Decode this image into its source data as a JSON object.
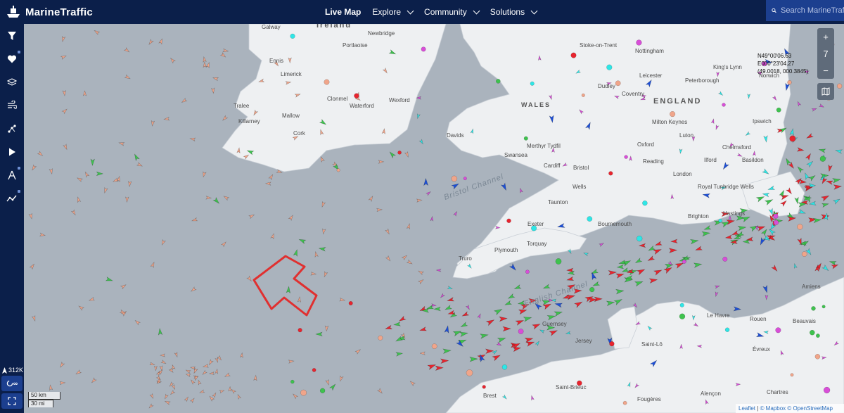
{
  "header": {
    "logo_text": "MarineTraffic",
    "nav": [
      {
        "label": "Live Map",
        "active": true
      },
      {
        "label": "Explore",
        "active": false
      },
      {
        "label": "Community",
        "active": false
      },
      {
        "label": "Solutions",
        "active": false
      }
    ],
    "search_placeholder": "Search MarineTraffic"
  },
  "sidebar": {
    "buttons": [
      {
        "icon": "filter-icon"
      },
      {
        "icon": "heart-icon",
        "locked": true
      },
      {
        "icon": "layers-icon"
      },
      {
        "icon": "wind-icon"
      },
      {
        "icon": "measure-icon"
      },
      {
        "icon": "play-icon"
      },
      {
        "icon": "compass-icon",
        "locked": true
      },
      {
        "icon": "analytics-icon",
        "locked": true
      }
    ],
    "vessel_count": "312K",
    "layer_label": "∞"
  },
  "map": {
    "zoom_level": "7",
    "coordinates": [
      "N49°00'06.63",
      "E000°23'04.27",
      "(49.0018, 000.3845)"
    ],
    "scale": {
      "metric": "50 km",
      "imperial": "30 mi"
    },
    "attribution": {
      "leaflet": "Leaflet",
      "mapbox": "© Mapbox",
      "osm": "© OpenStreetMap"
    },
    "places": {
      "ireland": "Ireland",
      "galway": "Galway",
      "newbridge": "Newbridge",
      "portlaoise": "Portlaoise",
      "ennis": "Ennis",
      "limerick": "Limerick",
      "clonmel": "Clonmel",
      "waterford": "Waterford",
      "wexford": "Wexford",
      "tralee": "Tralee",
      "mallow": "Mallow",
      "killarney": "Killarney",
      "cork": "Cork",
      "wales": "WALES",
      "davids": "Davids",
      "swansea": "Swansea",
      "merthyr": "Merthyr Tydfil",
      "cardiff": "Cardiff",
      "bristol": "Bristol",
      "wells": "Wells",
      "taunton": "Taunton",
      "bristol_channel": "Bristol Channel",
      "england": "ENGLAND",
      "stoke": "Stoke-on-Trent",
      "nottingham": "Nottingham",
      "leicester": "Leicester",
      "peterborough": "Peterborough",
      "kings_lynn": "King's Lynn",
      "norwich": "Norwich",
      "dudley": "Dudley",
      "coventry": "Coventry",
      "milton_keynes": "Milton Keynes",
      "luton": "Luton",
      "ipswich": "Ipswich",
      "oxford": "Oxford",
      "chelmsford": "Chelmsford",
      "reading": "Reading",
      "london": "London",
      "ilford": "Ilford",
      "basildon": "Basildon",
      "royal_tunbridge": "Royal Tunbridge Wells",
      "exeter": "Exeter",
      "bournemouth": "Bournemouth",
      "brighton": "Brighton",
      "hastings": "Hastings",
      "torquay": "Torquay",
      "plymouth": "Plymouth",
      "truro": "Truro",
      "english_channel": "English Channel",
      "guernsey": "Guernsey",
      "jersey": "Jersey",
      "amiens": "Amiens",
      "le_havre": "Le Havre",
      "rouen": "Rouen",
      "beauvais": "Beauvais",
      "saint_lo": "Saint-Lô",
      "evreux": "Évreux",
      "saint_brieuc": "Saint-Brieuc",
      "alencon": "Alençon",
      "brest": "Brest",
      "chartres": "Chartres",
      "fougeres": "Fougères"
    }
  },
  "colors": {
    "header_bg": "#0b1f4a",
    "sea": "#aab3bd",
    "land": "#eef0f2",
    "cargo": "#3ec24e",
    "tanker": "#e8242e",
    "fishing": "#f0a58a",
    "passenger": "#1d4fd6",
    "pleasure": "#d84ed8",
    "tug": "#2ee6e6",
    "annotation_arrow": "#e03030"
  }
}
